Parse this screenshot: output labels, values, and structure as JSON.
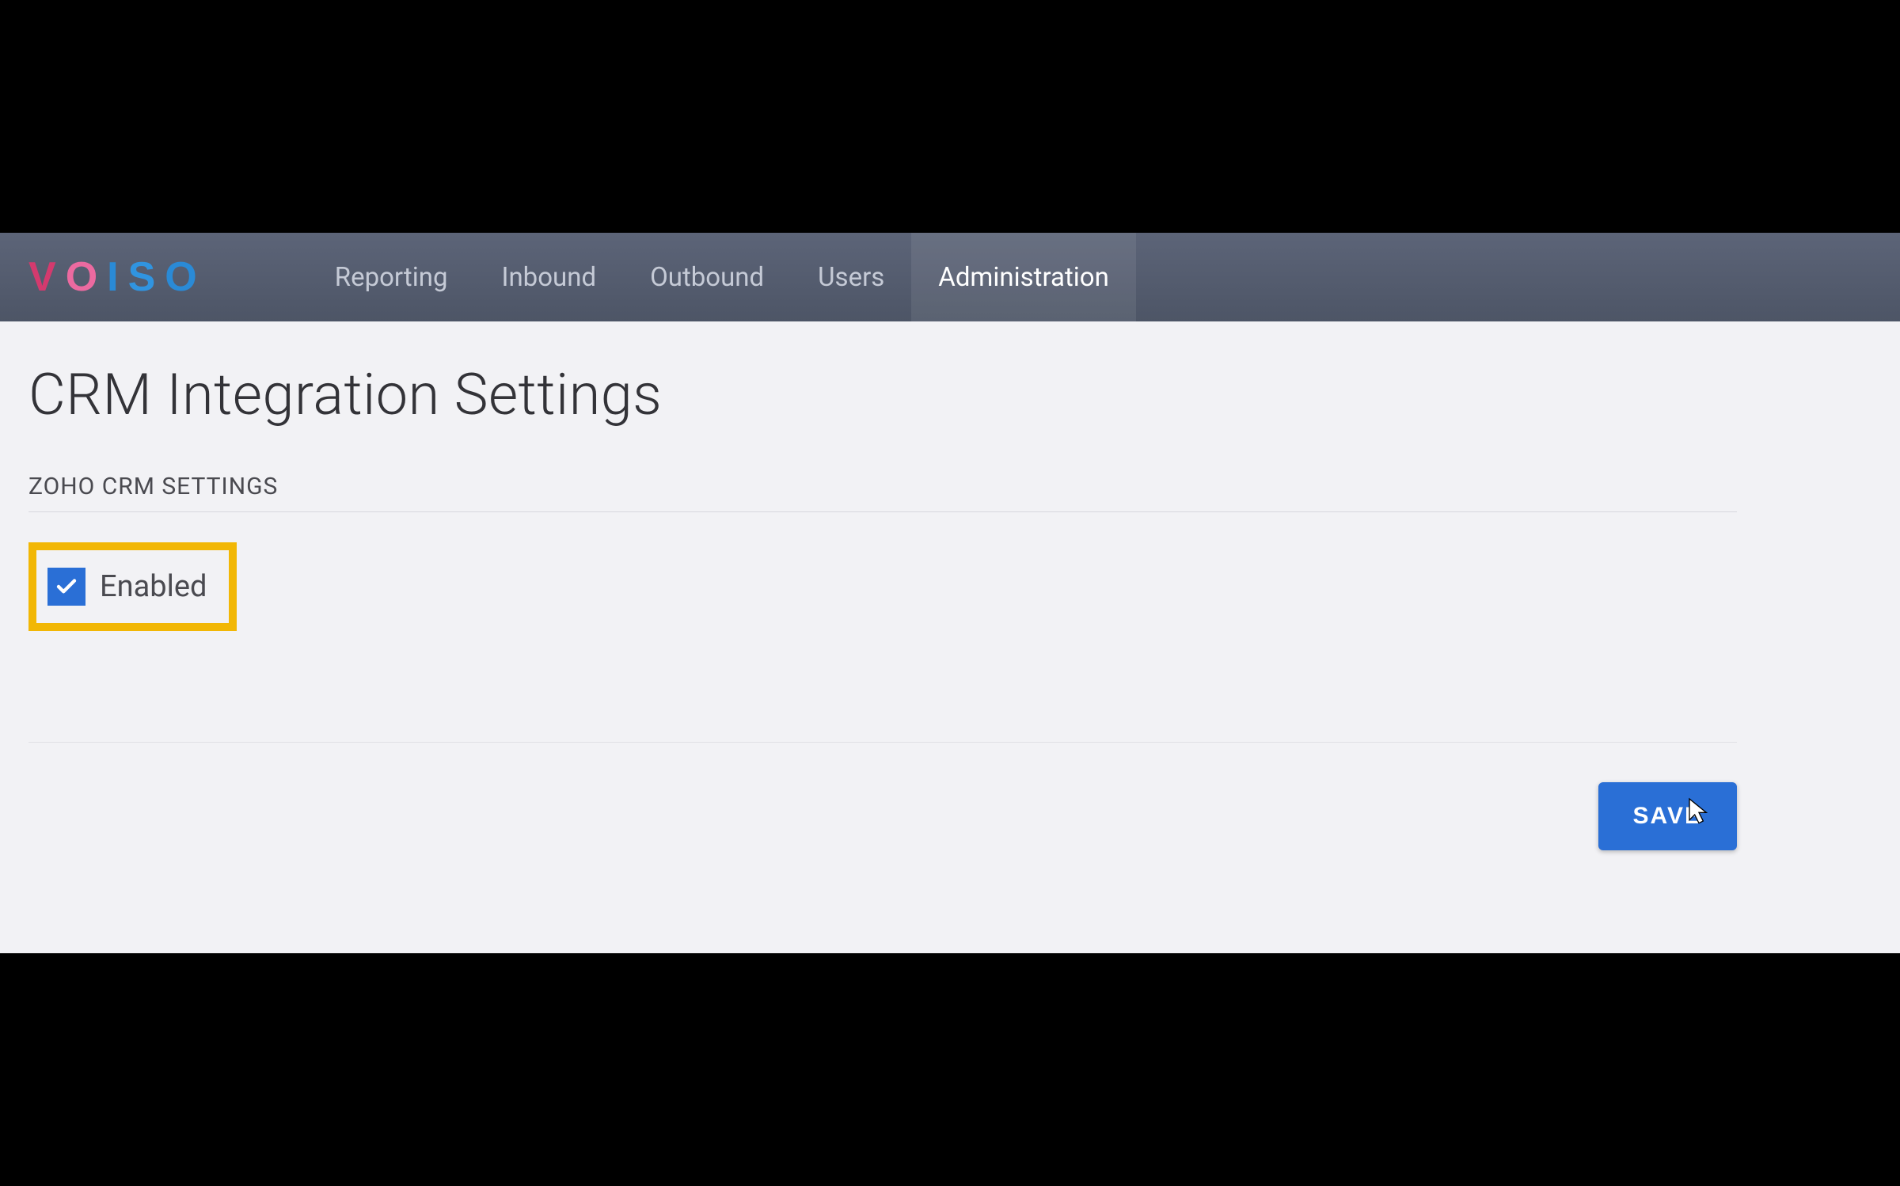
{
  "logo": {
    "letters": [
      "V",
      "O",
      "I",
      "S",
      "O"
    ]
  },
  "nav": {
    "items": [
      {
        "label": "Reporting",
        "active": false
      },
      {
        "label": "Inbound",
        "active": false
      },
      {
        "label": "Outbound",
        "active": false
      },
      {
        "label": "Users",
        "active": false
      },
      {
        "label": "Administration",
        "active": true
      }
    ]
  },
  "page": {
    "title": "CRM Integration Settings"
  },
  "section": {
    "heading": "ZOHO CRM SETTINGS",
    "enabled": {
      "label": "Enabled",
      "checked": true
    }
  },
  "actions": {
    "save_label": "SAVE"
  }
}
